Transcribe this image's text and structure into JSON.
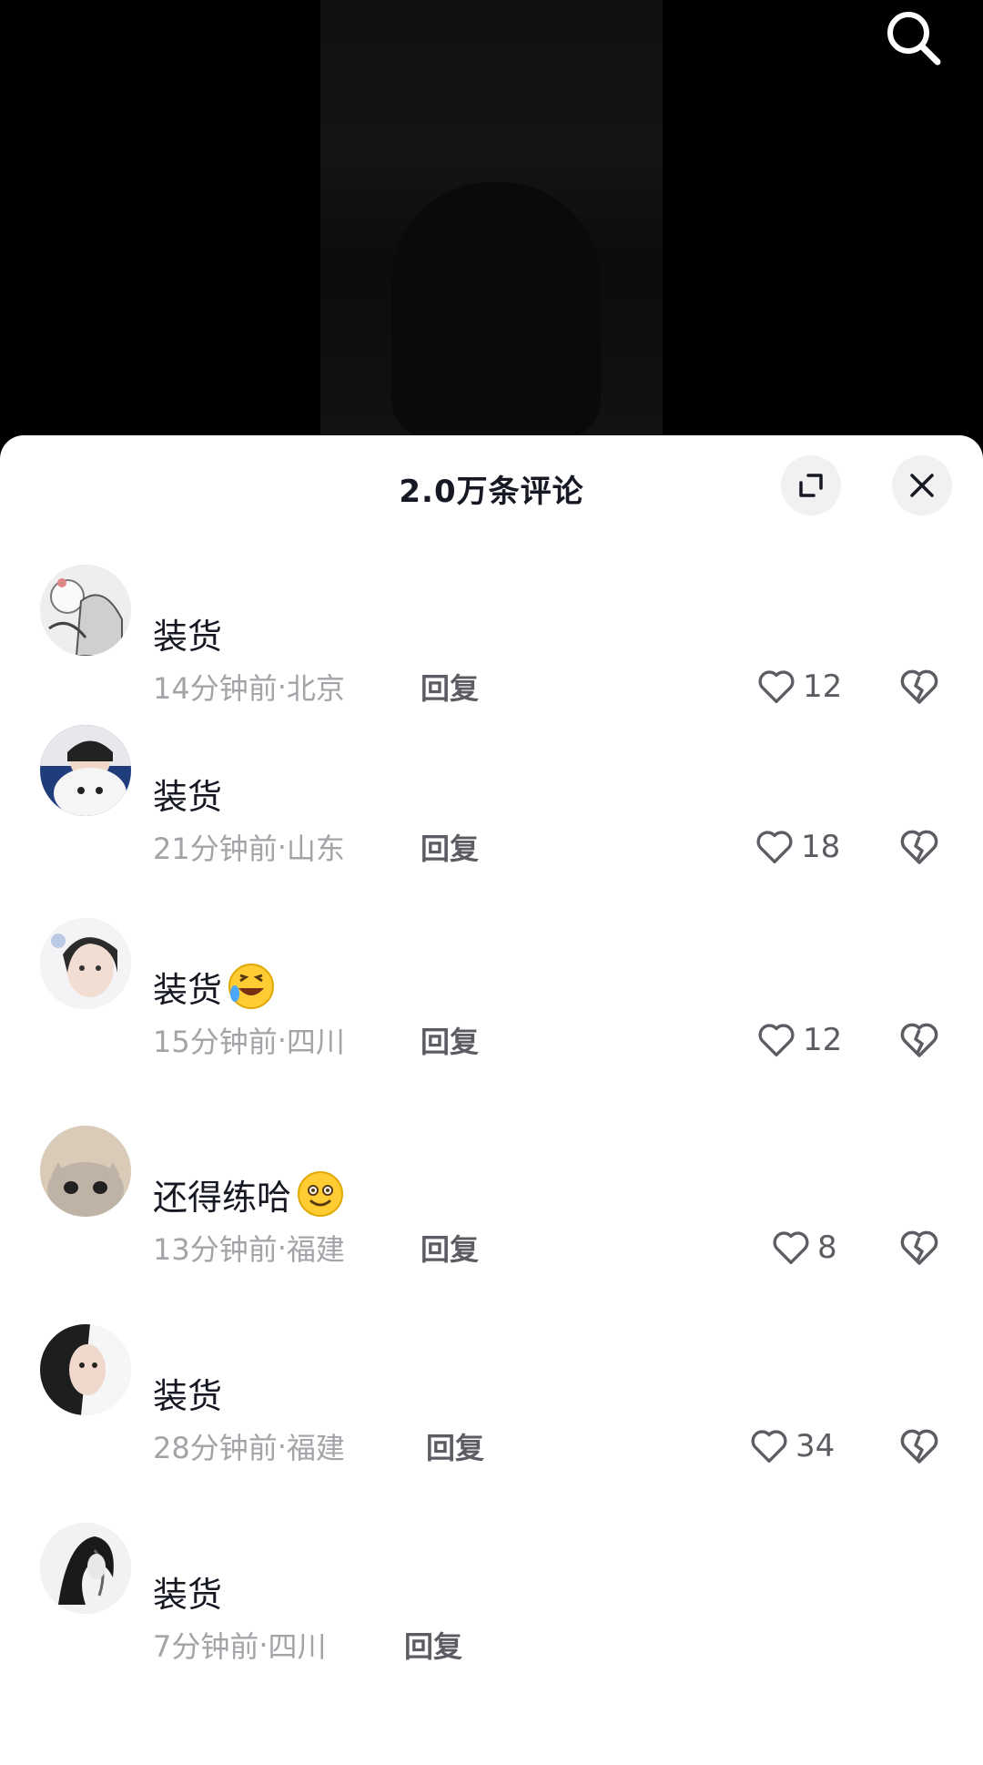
{
  "sheet": {
    "title": "2.0万条评论"
  },
  "icons": {
    "search": "search-icon",
    "expand": "expand-icon",
    "close": "close-icon",
    "like": "heart-outline-icon",
    "dislike": "broken-heart-icon"
  },
  "comments": [
    {
      "text": "装货",
      "time": "14分钟前",
      "location": "北京",
      "reply": "回复",
      "likes": "12"
    },
    {
      "text": "装货",
      "time": "21分钟前",
      "location": "山东",
      "reply": "回复",
      "likes": "18"
    },
    {
      "text": "装货",
      "time": "15分钟前",
      "location": "四川",
      "reply": "回复",
      "likes": "12",
      "emoji": "rofl-emoji"
    },
    {
      "text": "还得练哈",
      "time": "13分钟前",
      "location": "福建",
      "reply": "回复",
      "likes": "8",
      "emoji": "smile-emoji"
    },
    {
      "text": "装货",
      "time": "28分钟前",
      "location": "福建",
      "reply": "回复",
      "likes": "34"
    },
    {
      "text": "装货",
      "time": "7分钟前",
      "location": "四川",
      "reply": "回复"
    }
  ],
  "meta_separator": " · "
}
